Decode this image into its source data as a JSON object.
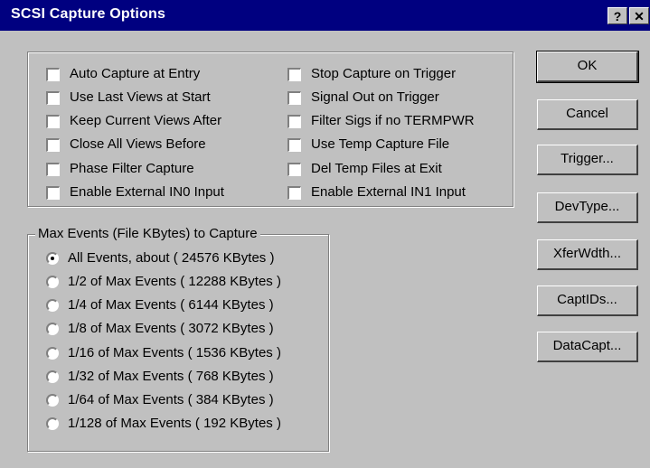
{
  "window": {
    "title": "SCSI Capture Options",
    "help_glyph": "?",
    "close_glyph": "✕"
  },
  "options_left": [
    {
      "label": "Auto Capture at Entry",
      "checked": false
    },
    {
      "label": "Use Last Views at Start",
      "checked": false
    },
    {
      "label": "Keep Current Views After",
      "checked": false
    },
    {
      "label": "Close All Views Before",
      "checked": false
    },
    {
      "label": "Phase Filter Capture",
      "checked": false
    },
    {
      "label": "Enable External IN0 Input",
      "checked": false
    }
  ],
  "options_right": [
    {
      "label": "Stop Capture on Trigger",
      "checked": false
    },
    {
      "label": "Signal Out on Trigger",
      "checked": false
    },
    {
      "label": "Filter Sigs if no TERMPWR",
      "checked": false
    },
    {
      "label": "Use Temp Capture File",
      "checked": false
    },
    {
      "label": "Del Temp Files at Exit",
      "checked": false
    },
    {
      "label": "Enable External IN1 Input",
      "checked": false
    }
  ],
  "max_events": {
    "title": "Max Events (File KBytes) to Capture",
    "selected": "All Events, about ( 24576 KBytes )",
    "options": [
      "All Events, about ( 24576 KBytes )",
      "1/2 of Max Events ( 12288 KBytes )",
      "1/4 of Max Events ( 6144 KBytes )",
      "1/8 of Max Events ( 3072 KBytes )",
      "1/16 of Max Events ( 1536 KBytes )",
      "1/32 of Max Events ( 768 KBytes )",
      "1/64 of Max Events ( 384 KBytes )",
      "1/128 of Max Events ( 192 KBytes )"
    ]
  },
  "buttons": {
    "ok": "OK",
    "cancel": "Cancel",
    "trigger": "Trigger...",
    "devtype": "DevType...",
    "xferwdth": "XferWdth...",
    "captids": "CaptIDs...",
    "datacapt": "DataCapt..."
  }
}
